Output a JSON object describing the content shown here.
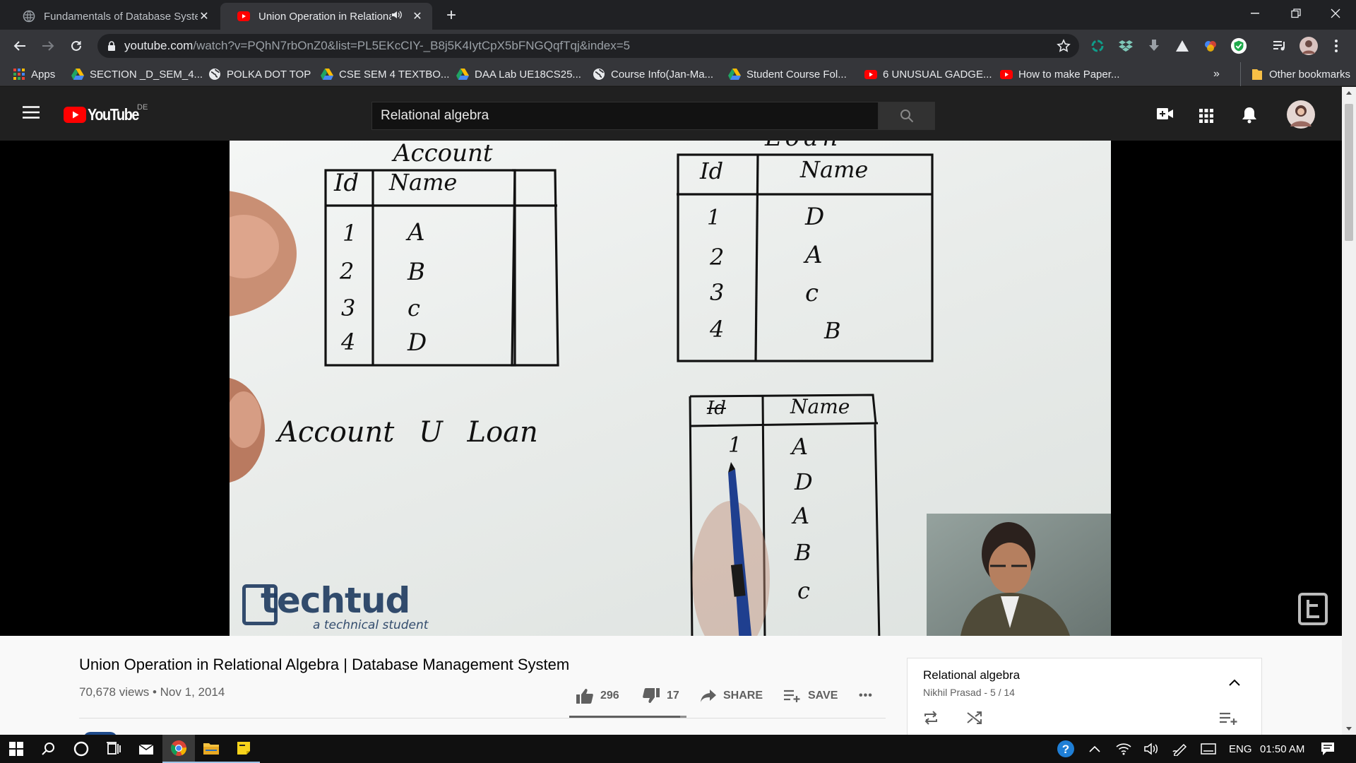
{
  "browser": {
    "tabs": [
      {
        "title": "Fundamentals of Database Syste"
      },
      {
        "title": "Union Operation in Relationa"
      }
    ],
    "url_host": "youtube.com",
    "url_path": "/watch?v=PQhN7rbOnZ0&list=PL5EKcCIY-_B8j5K4IytCpX5bFNGQqfTqj&index=5",
    "bookmarks": [
      {
        "label": "Apps",
        "icon": "apps-grid-icon"
      },
      {
        "label": "SECTION _D_SEM_4...",
        "icon": "google-drive-icon"
      },
      {
        "label": "POLKA DOT TOP",
        "icon": "globe-icon"
      },
      {
        "label": "CSE SEM 4 TEXTBO...",
        "icon": "google-drive-icon"
      },
      {
        "label": "DAA Lab UE18CS25...",
        "icon": "google-drive-icon"
      },
      {
        "label": "Course Info(Jan-Ma...",
        "icon": "globe-icon"
      },
      {
        "label": "Student Course Fol...",
        "icon": "google-drive-icon"
      },
      {
        "label": "6 UNUSUAL GADGE...",
        "icon": "youtube-icon"
      },
      {
        "label": "How to make Paper...",
        "icon": "youtube-icon"
      }
    ],
    "more_bookmarks": "»",
    "other_bookmarks": "Other bookmarks"
  },
  "youtube": {
    "logo_text": "YouTube",
    "region": "DE",
    "search_value": "Relational algebra"
  },
  "video_frame": {
    "table1_title": "Account",
    "table1_headers": [
      "Id",
      "Name"
    ],
    "table1_rows": [
      [
        "1",
        "A"
      ],
      [
        "2",
        "B"
      ],
      [
        "3",
        "C"
      ],
      [
        "4",
        "D"
      ]
    ],
    "table2_title_partial": "Loan",
    "table2_headers": [
      "Id",
      "Name"
    ],
    "table2_rows": [
      [
        "1",
        "D"
      ],
      [
        "2",
        "A"
      ],
      [
        "3",
        "C"
      ],
      [
        "4",
        "B"
      ]
    ],
    "expression": "Account U Loan",
    "result_headers": [
      "Id",
      "Name"
    ],
    "result_values": [
      "1",
      "A",
      "D",
      "A",
      "B",
      "C"
    ],
    "watermark_brand": "techtud",
    "watermark_tagline": "a technical student"
  },
  "video": {
    "title": "Union Operation in Relational Algebra | Database Management System",
    "views": "70,678 views",
    "date": "Nov 1, 2014",
    "likes": "296",
    "like_ratio": 0.946,
    "dislikes": "17",
    "share_label": "SHARE",
    "save_label": "SAVE",
    "more": "•••"
  },
  "playlist": {
    "title": "Relational algebra",
    "author": "Nikhil Prasad",
    "position": "5 / 14"
  },
  "taskbar": {
    "language": "ENG",
    "time": "01:50 AM"
  },
  "colors": {
    "youtube_red": "#ff0000",
    "chrome_dark": "#202124",
    "chrome_toolbar": "#35363a",
    "marker_black": "#111111",
    "watermark_blue": "#1e3a5f"
  }
}
